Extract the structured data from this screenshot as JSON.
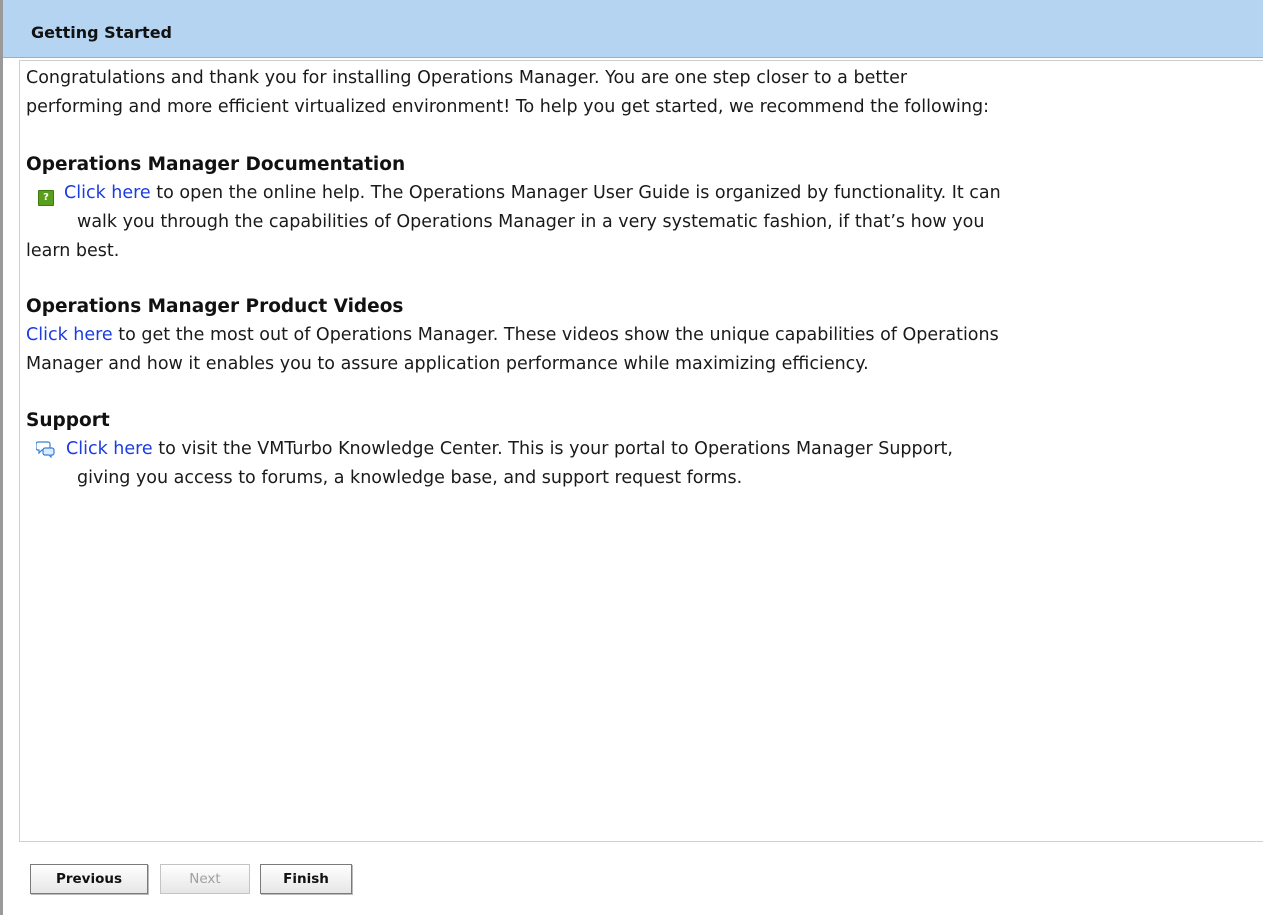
{
  "window": {
    "title": "Getting Started"
  },
  "intro": {
    "line1": "Congratulations and thank you for installing Operations Manager. You are one step closer to a better",
    "line2": "performing and more efficient virtualized environment! To help you get started, we recommend the following:"
  },
  "documentation": {
    "title": "Operations Manager Documentation",
    "icon": "help-book-icon",
    "icon_glyph": "?",
    "link": "Click here",
    "line1": " to open the online help. The Operations Manager User Guide is organized by functionality. It can",
    "line2": "walk you through the capabilities of Operations Manager in a very systematic fashion, if that’s how you",
    "line3": "learn best."
  },
  "videos": {
    "title": "Operations Manager Product Videos",
    "link": "Click here",
    "line1": " to get the most out of Operations Manager. These videos show the unique capabilities of Operations",
    "line2": "Manager and how it enables you to assure application performance while maximizing efficiency."
  },
  "support": {
    "title": "Support",
    "icon": "chat-bubbles-icon",
    "link": "Click here",
    "line1": " to visit the VMTurbo Knowledge Center. This is your portal to Operations Manager Support,",
    "line2": "giving you access to forums, a knowledge base, and support request forms."
  },
  "buttons": {
    "previous": "Previous",
    "next": "Next",
    "finish": "Finish"
  },
  "colors": {
    "titlebar": "#b4d4f2",
    "link": "#1a3ce0",
    "help_icon": "#5a9e1e"
  }
}
